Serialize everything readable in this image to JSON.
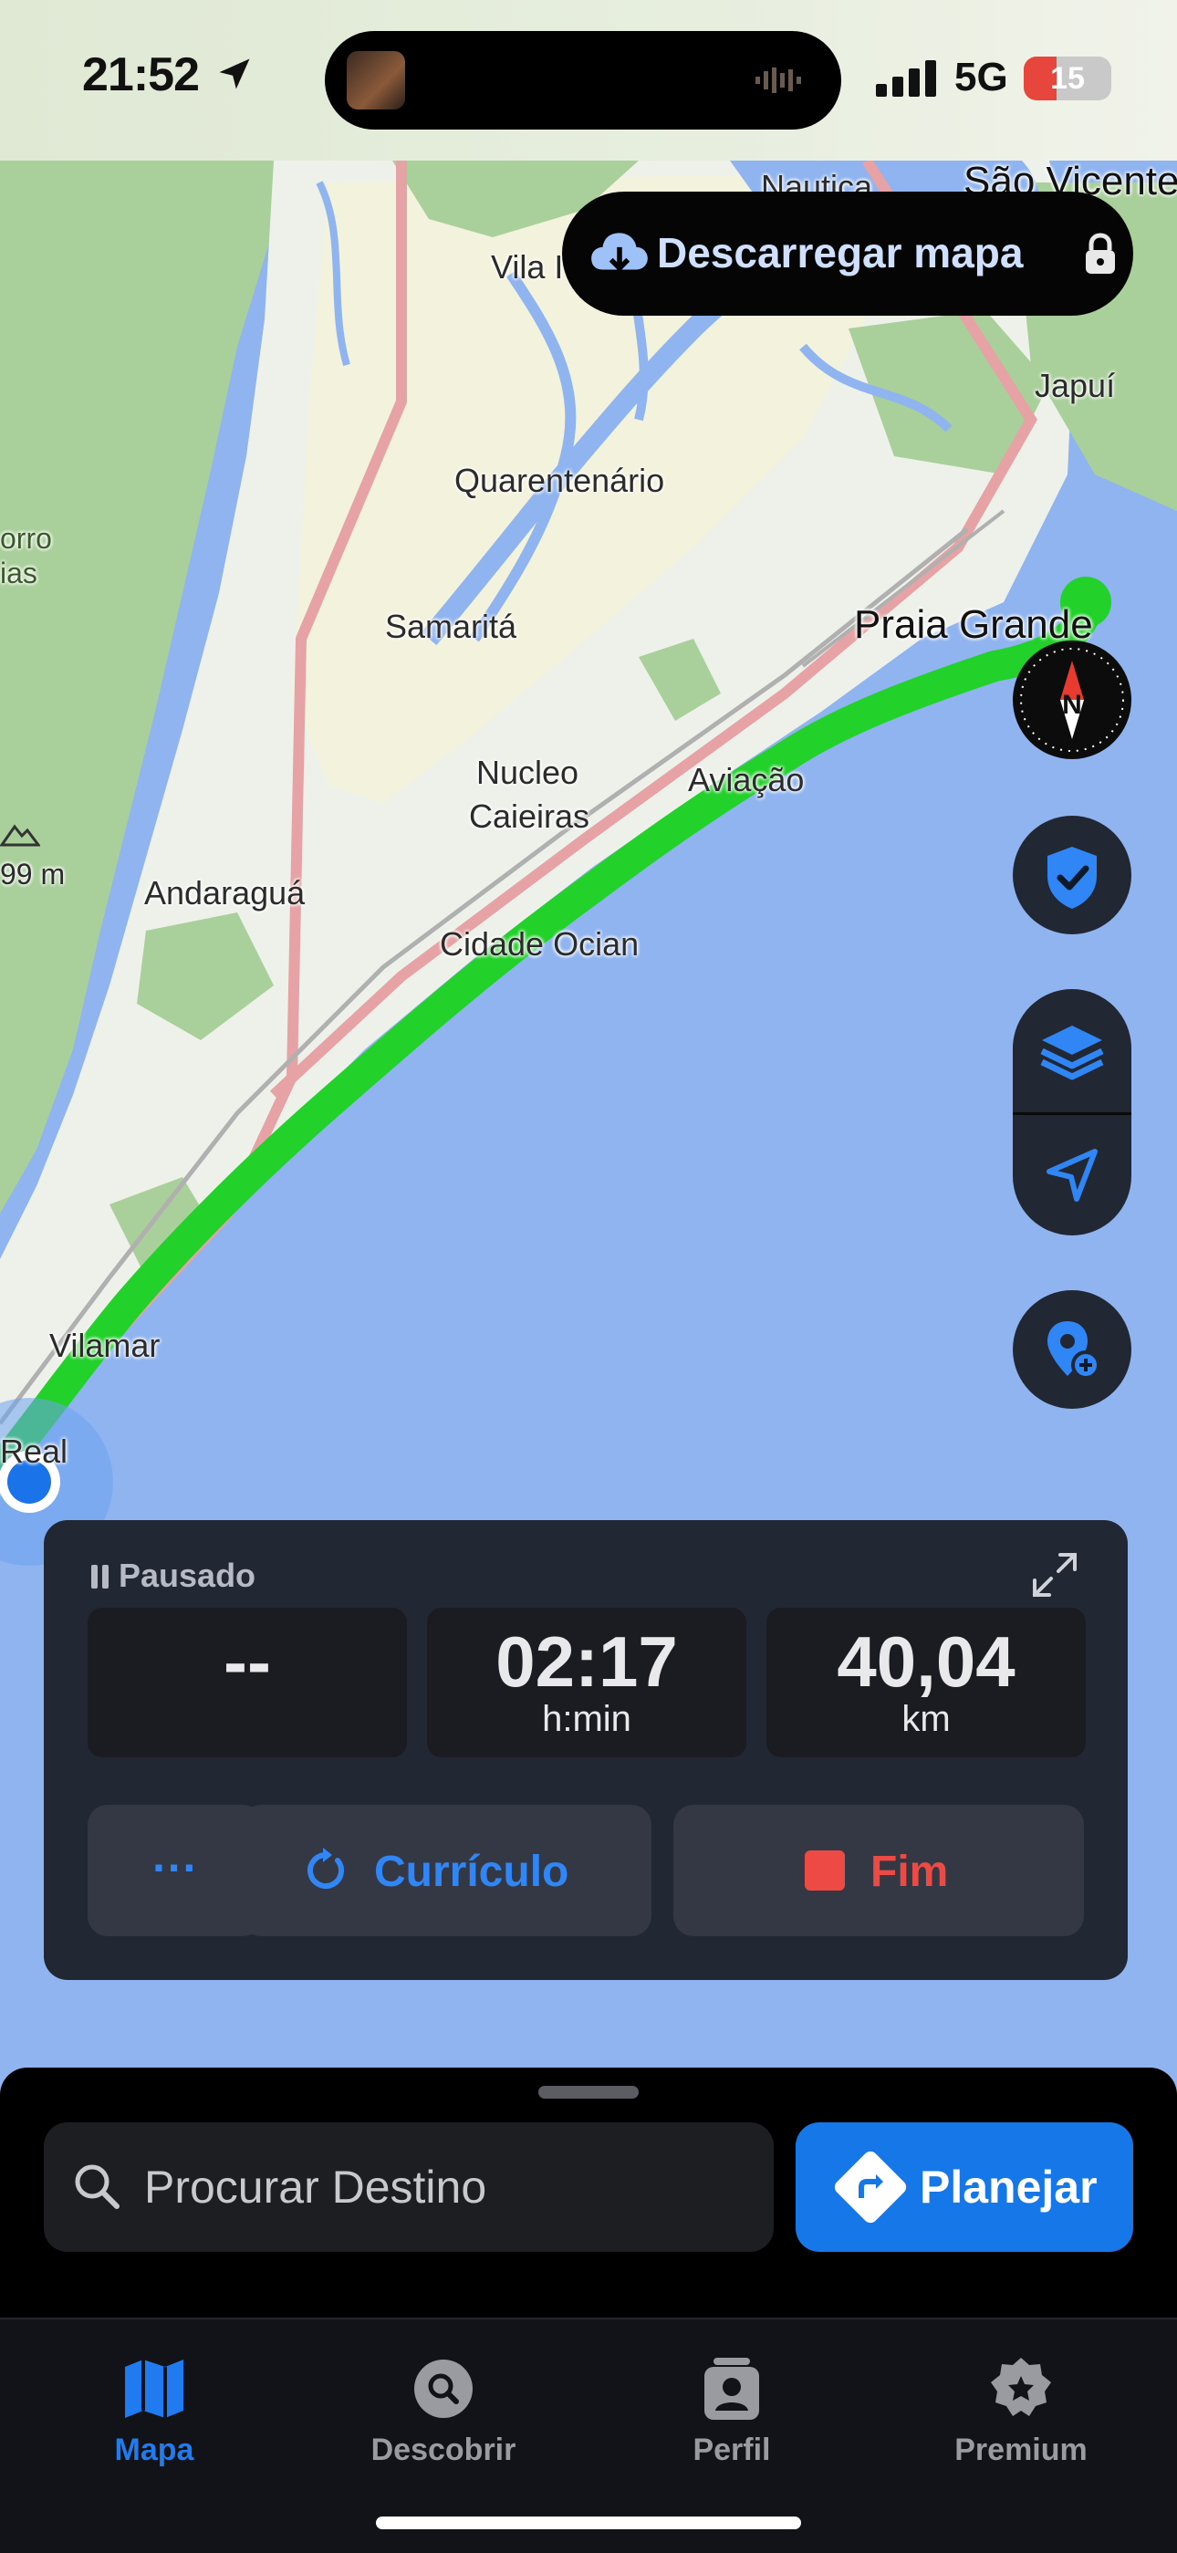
{
  "status_bar": {
    "time": "21:52",
    "network": "5G",
    "battery": "15",
    "battery_level": 0.15,
    "battery_color": "#e7463c"
  },
  "map": {
    "labels": {
      "nautica": "Nautica",
      "sao_vicente": "São Vicente",
      "vila": "Vila I",
      "japui": "Japuí",
      "quarentenario": "Quarentenário",
      "morro_1": "orro",
      "morro_2": "ias",
      "samarita": "Samaritá",
      "praia_grande": "Praia Grande",
      "nucleo_1": "Nucleo",
      "nucleo_2": "Caieiras",
      "aviacao": "Aviação",
      "elevation": "99 m",
      "andaragua": "Andaraguá",
      "cidade_ocian": "Cidade Ocian",
      "vilamar": "Vilamar",
      "real": "Real"
    },
    "colors": {
      "water": "#8fb4f0",
      "land": "#eef1ea",
      "forest": "#a9cf9a",
      "route": "#22d12a",
      "road": "#e6a2a4"
    }
  },
  "download": {
    "label": "Descarregar mapa"
  },
  "icons": {
    "download": "cloud-download-icon",
    "lock": "lock-icon",
    "compass": "compass-icon",
    "shield": "shield-check-icon",
    "layers": "layers-icon",
    "locate": "location-arrow-icon",
    "add_pin": "add-pin-icon",
    "expand": "expand-icon",
    "pause": "pause-icon",
    "search": "search-icon",
    "directions": "directions-icon"
  },
  "tracking": {
    "status": "Pausado",
    "stats": [
      {
        "value": "--",
        "unit": ""
      },
      {
        "value": "02:17",
        "unit": "h:min"
      },
      {
        "value": "40,04",
        "unit": "km"
      }
    ],
    "more_label": "···",
    "resume_label": "Currículo",
    "end_label": "Fim"
  },
  "search": {
    "placeholder": "Procurar Destino"
  },
  "plan": {
    "label": "Planejar"
  },
  "tabs": [
    {
      "label": "Mapa",
      "icon": "map-icon",
      "active": true
    },
    {
      "label": "Descobrir",
      "icon": "discover-icon",
      "active": false
    },
    {
      "label": "Perfil",
      "icon": "profile-icon",
      "active": false
    },
    {
      "label": "Premium",
      "icon": "premium-icon",
      "active": false
    }
  ],
  "accent_color": "#1f7bef"
}
